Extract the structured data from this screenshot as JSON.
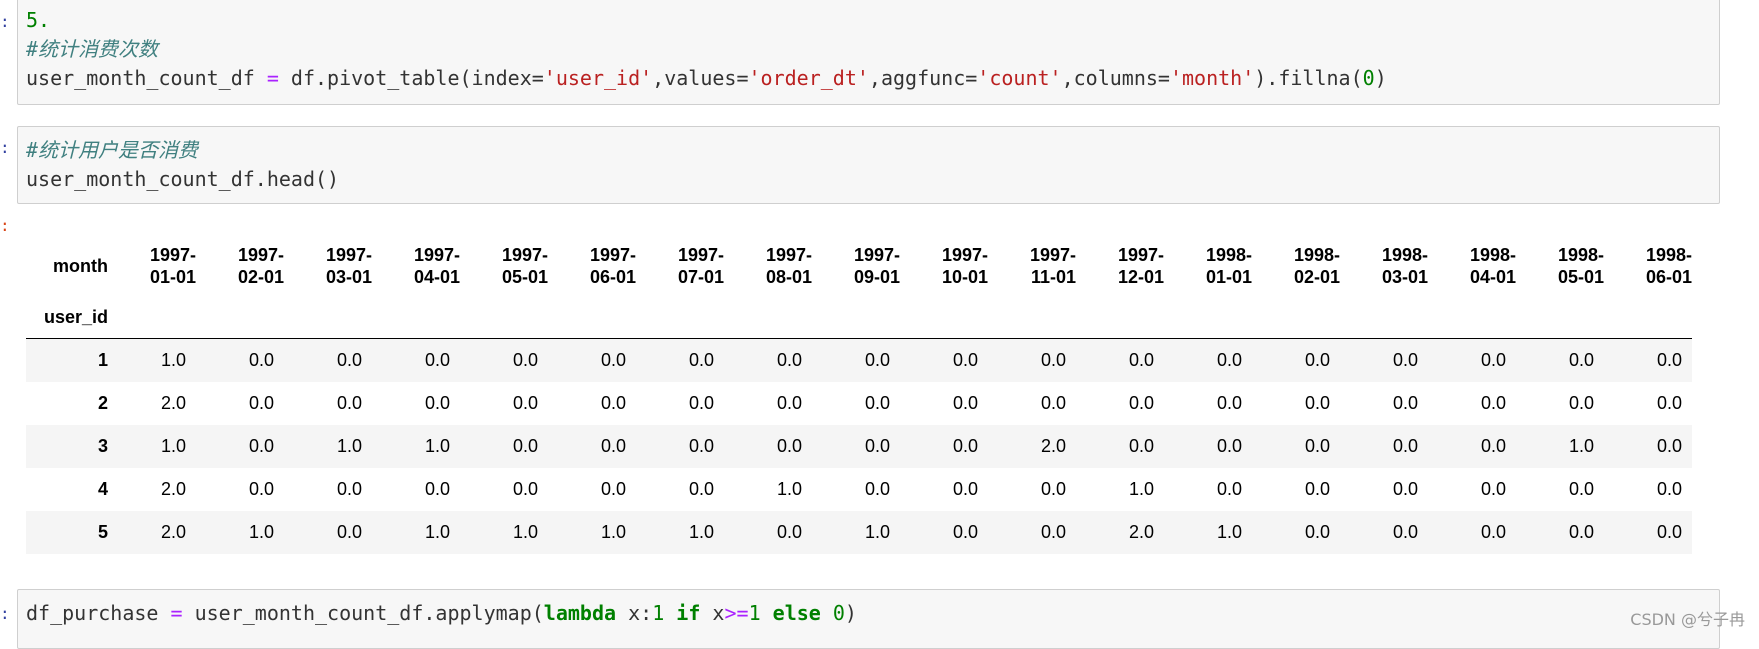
{
  "cells": {
    "cell1": {
      "line1": "5.",
      "comment": "#统计消费次数",
      "code_var": "user_month_count_df",
      "code_eq": "=",
      "code_call": "df.pivot_table(index=",
      "s_user_id": "'user_id'",
      "code_values": ",values=",
      "s_order_dt": "'order_dt'",
      "code_aggfunc": ",aggfunc=",
      "s_count": "'count'",
      "code_columns": ",columns=",
      "s_month": "'month'",
      "code_fillna": ").fillna(",
      "n_zero": "0",
      "code_close": ")"
    },
    "cell2": {
      "comment": "#统计用户是否消费",
      "code": "user_month_count_df.head()"
    },
    "cell3": {
      "code_var": "df_purchase",
      "code_eq": "=",
      "code_call": "user_month_count_df.applymap(",
      "kw_lambda": "lambda",
      "code_x": "x:",
      "n_one": "1",
      "kw_if": "if",
      "code_x2": "x",
      "op_ge": ">=",
      "n_one2": "1",
      "kw_else": "else",
      "n_zero": "0",
      "code_close": ")"
    }
  },
  "prompts": {
    "in": ":",
    "out": ":"
  },
  "table": {
    "columns_name": "month",
    "index_name": "user_id",
    "columns": [
      [
        "1997-",
        "01-01"
      ],
      [
        "1997-",
        "02-01"
      ],
      [
        "1997-",
        "03-01"
      ],
      [
        "1997-",
        "04-01"
      ],
      [
        "1997-",
        "05-01"
      ],
      [
        "1997-",
        "06-01"
      ],
      [
        "1997-",
        "07-01"
      ],
      [
        "1997-",
        "08-01"
      ],
      [
        "1997-",
        "09-01"
      ],
      [
        "1997-",
        "10-01"
      ],
      [
        "1997-",
        "11-01"
      ],
      [
        "1997-",
        "12-01"
      ],
      [
        "1998-",
        "01-01"
      ],
      [
        "1998-",
        "02-01"
      ],
      [
        "1998-",
        "03-01"
      ],
      [
        "1998-",
        "04-01"
      ],
      [
        "1998-",
        "05-01"
      ],
      [
        "1998-",
        "06-01"
      ]
    ],
    "rows": [
      {
        "index": "1",
        "values": [
          "1.0",
          "0.0",
          "0.0",
          "0.0",
          "0.0",
          "0.0",
          "0.0",
          "0.0",
          "0.0",
          "0.0",
          "0.0",
          "0.0",
          "0.0",
          "0.0",
          "0.0",
          "0.0",
          "0.0",
          "0.0"
        ]
      },
      {
        "index": "2",
        "values": [
          "2.0",
          "0.0",
          "0.0",
          "0.0",
          "0.0",
          "0.0",
          "0.0",
          "0.0",
          "0.0",
          "0.0",
          "0.0",
          "0.0",
          "0.0",
          "0.0",
          "0.0",
          "0.0",
          "0.0",
          "0.0"
        ]
      },
      {
        "index": "3",
        "values": [
          "1.0",
          "0.0",
          "1.0",
          "1.0",
          "0.0",
          "0.0",
          "0.0",
          "0.0",
          "0.0",
          "0.0",
          "2.0",
          "0.0",
          "0.0",
          "0.0",
          "0.0",
          "0.0",
          "1.0",
          "0.0"
        ]
      },
      {
        "index": "4",
        "values": [
          "2.0",
          "0.0",
          "0.0",
          "0.0",
          "0.0",
          "0.0",
          "0.0",
          "1.0",
          "0.0",
          "0.0",
          "0.0",
          "1.0",
          "0.0",
          "0.0",
          "0.0",
          "0.0",
          "0.0",
          "0.0"
        ]
      },
      {
        "index": "5",
        "values": [
          "2.0",
          "1.0",
          "0.0",
          "1.0",
          "1.0",
          "1.0",
          "1.0",
          "0.0",
          "1.0",
          "0.0",
          "0.0",
          "2.0",
          "1.0",
          "0.0",
          "0.0",
          "0.0",
          "0.0",
          "0.0"
        ]
      }
    ]
  },
  "watermark": "CSDN @兮子冉"
}
